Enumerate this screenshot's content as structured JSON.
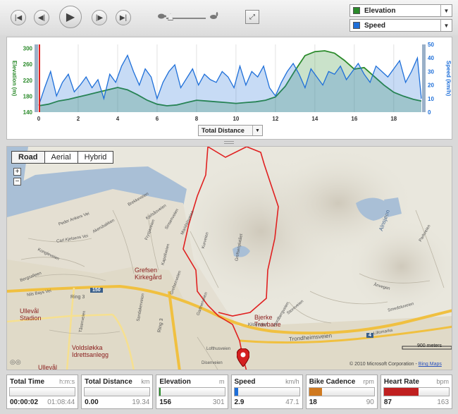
{
  "player": {
    "buttons": [
      "skip-to-start",
      "step-back",
      "play",
      "step-forward",
      "skip-to-end"
    ]
  },
  "series_selectors": [
    {
      "label": "Elevation",
      "color": "#2a8a2a"
    },
    {
      "label": "Speed",
      "color": "#1e6fd9"
    }
  ],
  "chart_data": {
    "type": "area",
    "x_axis_selector": "Total Distance",
    "x_ticks": [
      0,
      2,
      4,
      6,
      8,
      10,
      12,
      14,
      16,
      18
    ],
    "xlim": [
      0,
      19.4
    ],
    "left_axis": {
      "label": "Elevation (m)",
      "ticks": [
        140,
        180,
        220,
        260,
        300
      ],
      "range": [
        140,
        310
      ],
      "color": "#2a8a2a"
    },
    "right_axis": {
      "label": "Speed (km/h)",
      "ticks": [
        0,
        10,
        20,
        30,
        40,
        50
      ],
      "range": [
        0,
        50
      ],
      "color": "#1e6fd9"
    },
    "series": [
      {
        "name": "Elevation",
        "axis": "left",
        "color": "#2a8a2a",
        "x": [
          0,
          0.5,
          1,
          1.5,
          2,
          2.5,
          3,
          3.5,
          4,
          4.5,
          5,
          5.5,
          6,
          6.5,
          7,
          7.5,
          8,
          8.5,
          9,
          9.5,
          10,
          10.5,
          11,
          11.5,
          12,
          12.5,
          13,
          13.5,
          14,
          14.5,
          15,
          15.5,
          16,
          16.5,
          17,
          17.5,
          18,
          18.5,
          19,
          19.4
        ],
        "values": [
          156,
          160,
          168,
          172,
          178,
          184,
          190,
          196,
          202,
          196,
          184,
          170,
          160,
          156,
          158,
          164,
          170,
          168,
          166,
          164,
          162,
          164,
          166,
          170,
          178,
          205,
          245,
          282,
          292,
          294,
          288,
          270,
          248,
          252,
          230,
          208,
          190,
          180,
          172,
          168
        ]
      },
      {
        "name": "Speed",
        "axis": "right",
        "color": "#1e6fd9",
        "x": [
          0,
          0.3,
          0.6,
          0.9,
          1.2,
          1.5,
          1.8,
          2.1,
          2.4,
          2.7,
          3,
          3.3,
          3.6,
          3.9,
          4.2,
          4.5,
          4.8,
          5.1,
          5.4,
          5.7,
          6,
          6.3,
          6.6,
          6.9,
          7.2,
          7.5,
          7.8,
          8.1,
          8.4,
          8.7,
          9,
          9.3,
          9.6,
          9.9,
          10.2,
          10.5,
          10.8,
          11.1,
          11.4,
          11.7,
          12,
          12.3,
          12.6,
          12.9,
          13.2,
          13.5,
          13.8,
          14.1,
          14.4,
          14.7,
          15,
          15.3,
          15.6,
          15.9,
          16.2,
          16.5,
          16.8,
          17.1,
          17.4,
          17.7,
          18,
          18.3,
          18.6,
          18.9,
          19.2,
          19.4
        ],
        "values": [
          5,
          18,
          30,
          12,
          22,
          28,
          15,
          20,
          26,
          18,
          24,
          10,
          28,
          22,
          34,
          42,
          30,
          20,
          32,
          26,
          10,
          22,
          30,
          35,
          18,
          25,
          32,
          20,
          28,
          24,
          22,
          30,
          26,
          18,
          34,
          20,
          30,
          26,
          34,
          18,
          12,
          22,
          30,
          36,
          28,
          18,
          32,
          26,
          20,
          30,
          28,
          34,
          24,
          30,
          36,
          28,
          22,
          34,
          30,
          26,
          32,
          38,
          22,
          30,
          40,
          10
        ]
      }
    ]
  },
  "map": {
    "tabs": [
      "Road",
      "Aerial",
      "Hybrid"
    ],
    "selected_tab": "Road",
    "zoom_in": "+",
    "zoom_out": "−",
    "places": [
      {
        "text": "Grefsen\nKirkegård"
      },
      {
        "text": "Ullevål\nStadion"
      },
      {
        "text": "Voldsløkka\nIdrettsanlegg"
      },
      {
        "text": "Bjerke\nTravbane"
      },
      {
        "text": "Ullevål"
      }
    ],
    "streets": [
      "Kjelsåsveien",
      "Grefsenveien",
      "Trondheimsveien",
      "Kildeveien",
      "Ring 3",
      "Ring 3",
      "Tåsenveien",
      "Maridalsveien",
      "Sandakerveien",
      "Gartnerveien",
      "Lofthusveien",
      "Disenveien",
      "Brekkeveien",
      "Kurveien",
      "Akersbakken",
      "Sinsenveien",
      "Kapellveien",
      "Grefsenplatået",
      "Nordbergveien",
      "Storoveien",
      "Peder Ankers Vei",
      "Carl Kjelsens Vei",
      "Bergsalleen",
      "Kongleveien",
      "Nils Bays Vei",
      "Ånvegen",
      "Smedstuveien",
      "Parkveien",
      "Lillomarka",
      "Frysjaveien"
    ],
    "road_shields": [
      "150",
      "4"
    ],
    "scale": "900 meters",
    "copyright": "© 2010 Microsoft Corporation",
    "credit": "Bing Maps",
    "lake": "Alnsjøen"
  },
  "stats": [
    {
      "name": "Total Time",
      "unit": "h:m:s",
      "value": "00:00:02",
      "max": "01:08:44",
      "fill": 0.0,
      "color": "#888"
    },
    {
      "name": "Total Distance",
      "unit": "km",
      "value": "0.00",
      "max": "19.34",
      "fill": 0.0,
      "color": "#888"
    },
    {
      "name": "Elevation",
      "unit": "m",
      "value": "156",
      "max": "301",
      "fill": 0.02,
      "color": "#2a8a2a"
    },
    {
      "name": "Speed",
      "unit": "km/h",
      "value": "2.9",
      "max": "47.1",
      "fill": 0.06,
      "color": "#1e6fd9"
    },
    {
      "name": "Bike Cadence",
      "unit": "rpm",
      "value": "18",
      "max": "90",
      "fill": 0.2,
      "color": "#d07a20"
    },
    {
      "name": "Heart Rate",
      "unit": "bpm",
      "value": "87",
      "max": "163",
      "fill": 0.53,
      "color": "#c02020"
    }
  ]
}
